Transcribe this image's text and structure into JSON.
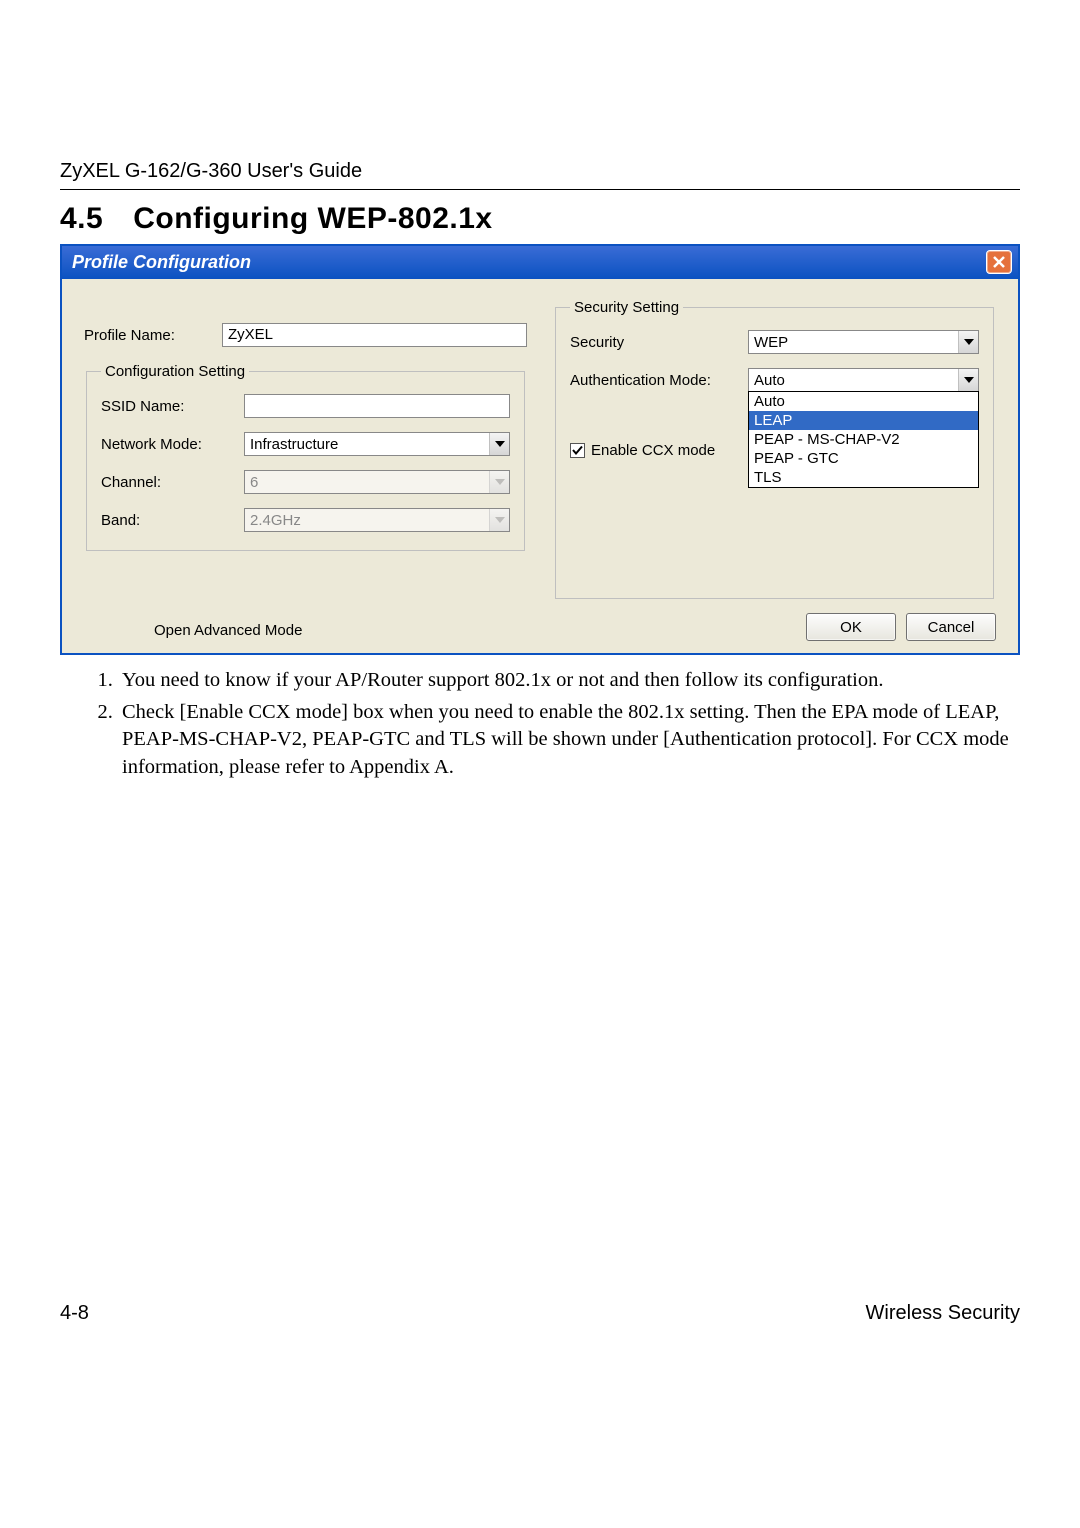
{
  "header": {
    "guide": "ZyXEL G-162/G-360 User's Guide"
  },
  "section": {
    "number": "4.5",
    "title": "Configuring WEP-802.1x"
  },
  "dialog": {
    "title": "Profile Configuration",
    "profile_name_label": "Profile Name:",
    "profile_name_value": "ZyXEL",
    "config_legend": "Configuration Setting",
    "ssid_label": "SSID Name:",
    "ssid_value": "",
    "network_mode_label": "Network Mode:",
    "network_mode_value": "Infrastructure",
    "channel_label": "Channel:",
    "channel_value": "6",
    "band_label": "Band:",
    "band_value": "2.4GHz",
    "security_legend": "Security Setting",
    "security_label": "Security",
    "security_value": "WEP",
    "auth_mode_label": "Authentication Mode:",
    "auth_mode_value": "Auto",
    "auth_mode_options": [
      "Auto",
      "LEAP",
      "PEAP - MS-CHAP-V2",
      "PEAP - GTC",
      "TLS"
    ],
    "auth_mode_highlight_index": 1,
    "enable_ccx_label": "Enable CCX mode",
    "enable_ccx_checked": true,
    "advanced_label": "Open Advanced Mode",
    "ok_label": "OK",
    "cancel_label": "Cancel"
  },
  "notes": [
    "You need to know if your AP/Router support 802.1x or not and then follow its configuration.",
    "Check [Enable CCX mode] box when you need to enable the 802.1x setting.  Then the EPA mode of LEAP, PEAP-MS-CHAP-V2, PEAP-GTC and TLS will be shown under [Authentication protocol].   For CCX mode information, please refer to Appendix A."
  ],
  "footer": {
    "left": "4-8",
    "right": "Wireless Security"
  }
}
